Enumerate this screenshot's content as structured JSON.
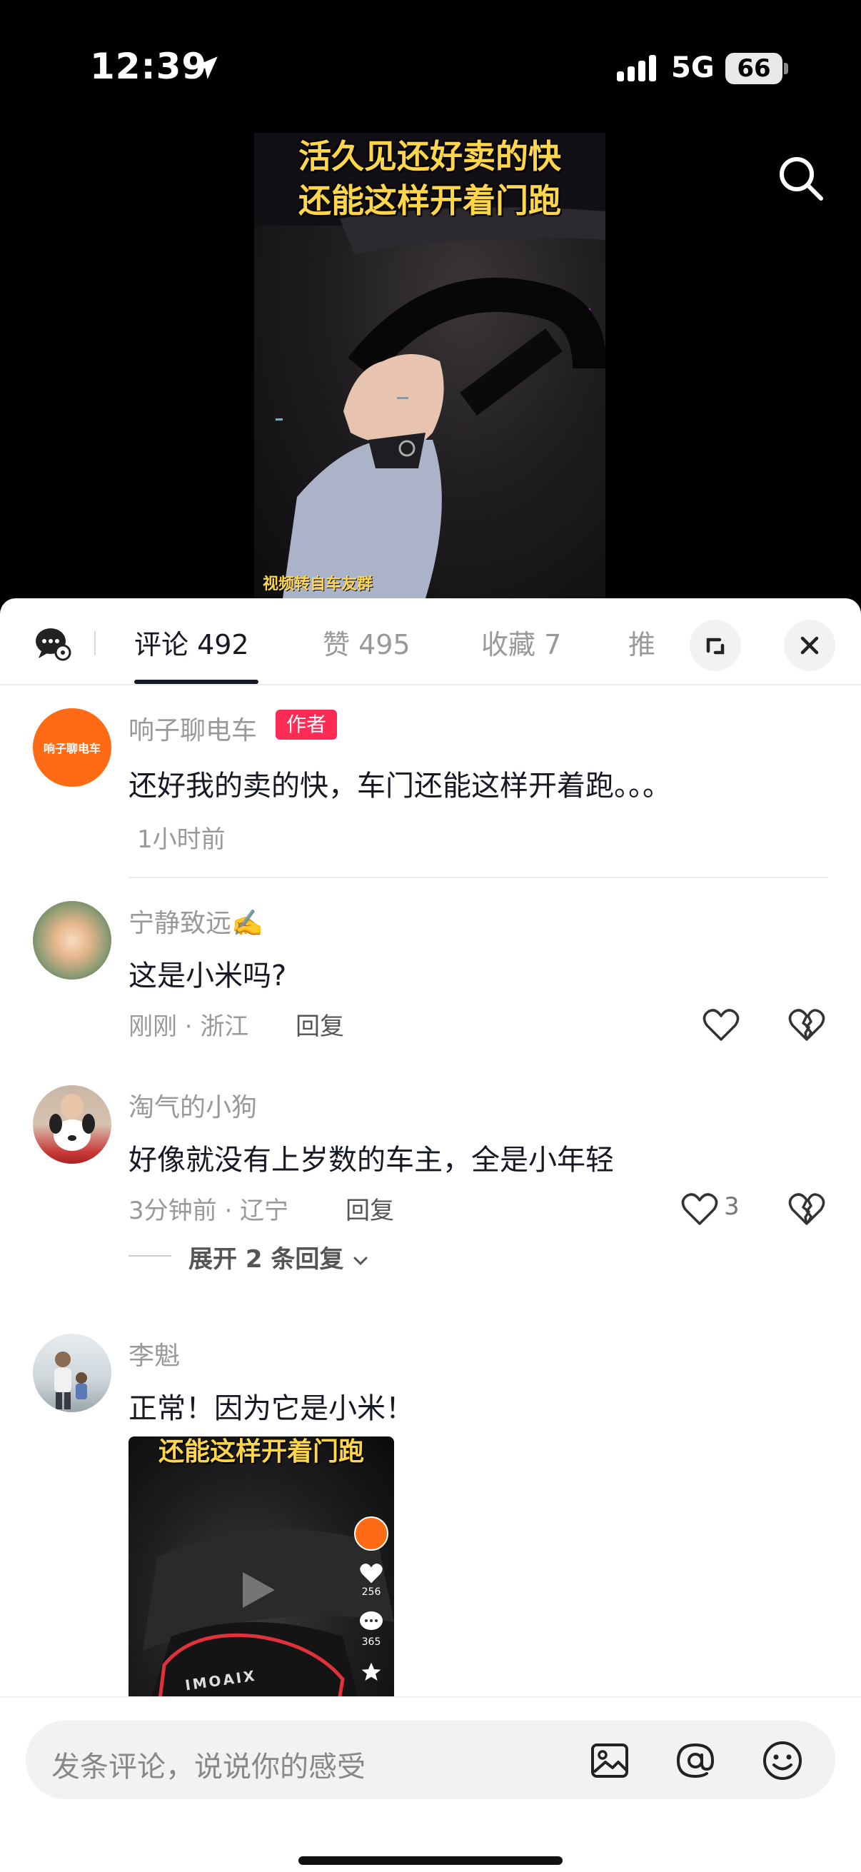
{
  "status_bar": {
    "time": "12:39",
    "network": "5G",
    "battery": "66"
  },
  "video": {
    "title_line1": "活久见还好卖的快",
    "title_line2": "还能这样开着门跑",
    "caption": "视频转自车友群"
  },
  "tabs": {
    "comments": "评论 492",
    "likes": "赞 495",
    "favorites": "收藏 7",
    "clipped": "推"
  },
  "comments": [
    {
      "author": "响子聊电车",
      "badge": "作者",
      "avatar_text": "响子聊电车",
      "text": "还好我的卖的快，车门还能这样开着跑。。。",
      "meta": "1小时前"
    },
    {
      "author": "宁静致远✍️",
      "text": "这是小米吗?",
      "meta": "刚刚 · 浙江",
      "reply": "回复"
    },
    {
      "author": "淘气的小狗",
      "text": "好像就没有上岁数的车主，全是小年轻",
      "meta": "3分钟前 · 辽宁",
      "reply": "回复",
      "likes": "3",
      "expand": "展开 2 条回复"
    },
    {
      "author": "李魁",
      "text": "正常！因为它是小米！"
    }
  ],
  "comment_image": {
    "title": "还能这样开着门跑",
    "like_count": "256",
    "comment_count": "365",
    "brand_text": "XIAOMI"
  },
  "input": {
    "placeholder": "发条评论，说说你的感受"
  },
  "colors": {
    "accent": "#fe2c55",
    "avatar_orange": "#ff6a14",
    "caption_yellow": "#ffd64a"
  }
}
